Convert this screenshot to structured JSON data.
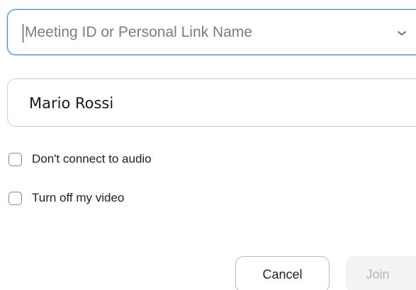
{
  "meeting_id": {
    "value": "",
    "placeholder": "Meeting ID or Personal Link Name",
    "dropdown_icon": "chevron-down-icon"
  },
  "name_field": {
    "value": "Mario Rossi"
  },
  "options": {
    "dont_connect_audio": {
      "label": "Don't connect to audio",
      "checked": false
    },
    "turn_off_video": {
      "label": "Turn off my video",
      "checked": false
    }
  },
  "buttons": {
    "cancel_label": "Cancel",
    "join_label": "Join",
    "join_enabled": false
  },
  "colors": {
    "focus_border": "#2d8cff",
    "disabled_text": "#b5b5b5"
  }
}
